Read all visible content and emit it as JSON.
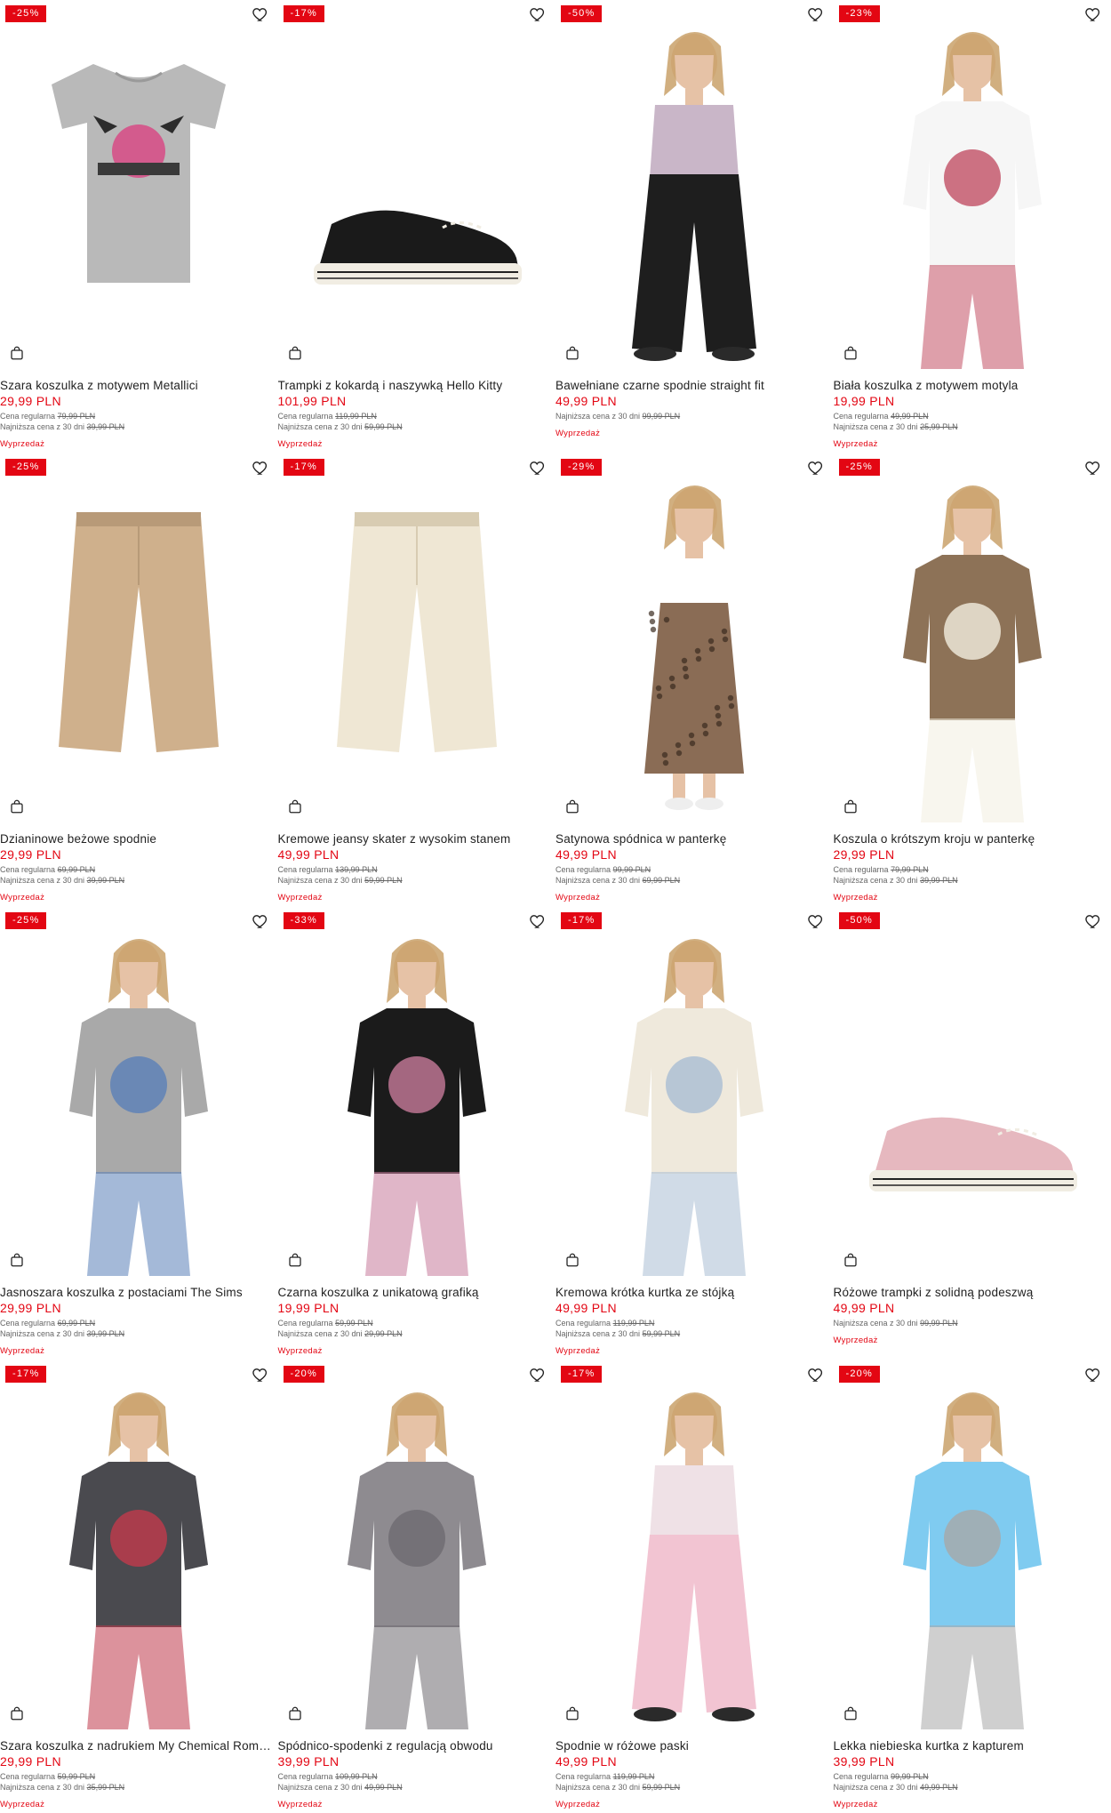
{
  "labels": {
    "regular": "Cena regularna",
    "lowest": "Najniższa cena z 30 dni",
    "sale": "Wyprzedaż"
  },
  "products": [
    {
      "name": "Szara koszulka z motywem Metallici",
      "price": "29,99 PLN",
      "badge": "-25%",
      "regular": "79,99 PLN",
      "lowest": "39,99 PLN",
      "kind": "tee",
      "color": "#b9b9b9",
      "accent": "#d35b8d"
    },
    {
      "name": "Trampki z kokardą i naszywką Hello Kitty",
      "price": "101,99 PLN",
      "badge": "-17%",
      "regular": "119,99 PLN",
      "lowest": "59,99 PLN",
      "kind": "shoe",
      "color": "#1a1a1a",
      "accent": "#f1ede3"
    },
    {
      "name": "Bawełniane czarne spodnie straight fit",
      "price": "49,99 PLN",
      "badge": "-50%",
      "regular": "",
      "lowest": "99,99 PLN",
      "kind": "pants-model",
      "color": "#1e1e1e",
      "accent": "#c9b6c8"
    },
    {
      "name": "Biała koszulka z motywem motyla",
      "price": "19,99 PLN",
      "badge": "-23%",
      "regular": "49,99 PLN",
      "lowest": "25,99 PLN",
      "kind": "model",
      "color": "#f6f6f6",
      "accent": "#c25065"
    },
    {
      "name": "Dzianinowe beżowe spodnie",
      "price": "29,99 PLN",
      "badge": "-25%",
      "regular": "69,99 PLN",
      "lowest": "39,99 PLN",
      "kind": "pants",
      "color": "#cfb08c",
      "accent": "#b89a78"
    },
    {
      "name": "Kremowe jeansy skater z wysokim stanem",
      "price": "49,99 PLN",
      "badge": "-17%",
      "regular": "139,99 PLN",
      "lowest": "59,99 PLN",
      "kind": "pants",
      "color": "#efe7d4",
      "accent": "#d8ccb2"
    },
    {
      "name": "Satynowa spódnica w panterkę",
      "price": "49,99 PLN",
      "badge": "-29%",
      "regular": "99,99 PLN",
      "lowest": "69,99 PLN",
      "kind": "skirt-model",
      "color": "#8a6c55",
      "accent": "#ffffff"
    },
    {
      "name": "Koszula o krótszym kroju w panterkę",
      "price": "29,99 PLN",
      "badge": "-25%",
      "regular": "79,99 PLN",
      "lowest": "39,99 PLN",
      "kind": "model",
      "color": "#8d7257",
      "accent": "#f3eee0"
    },
    {
      "name": "Jasnoszara koszulka z postaciami The Sims",
      "price": "29,99 PLN",
      "badge": "-25%",
      "regular": "69,99 PLN",
      "lowest": "39,99 PLN",
      "kind": "model",
      "color": "#a9a9a9",
      "accent": "#5a7fb8"
    },
    {
      "name": "Czarna koszulka z unikatową grafiką",
      "price": "19,99 PLN",
      "badge": "-33%",
      "regular": "59,99 PLN",
      "lowest": "29,99 PLN",
      "kind": "model",
      "color": "#1b1b1b",
      "accent": "#c77a9a"
    },
    {
      "name": "Kremowa krótka kurtka ze stójką",
      "price": "49,99 PLN",
      "badge": "-17%",
      "regular": "119,99 PLN",
      "lowest": "59,99 PLN",
      "kind": "model",
      "color": "#efe9dc",
      "accent": "#a9bdd3"
    },
    {
      "name": "Różowe trampki z solidną podeszwą",
      "price": "49,99 PLN",
      "badge": "-50%",
      "regular": "",
      "lowest": "99,99 PLN",
      "kind": "shoe",
      "color": "#e6b8bf",
      "accent": "#f1ede3"
    },
    {
      "name": "Szara koszulka z nadrukiem My Chemical Roma...",
      "price": "29,99 PLN",
      "badge": "-17%",
      "regular": "59,99 PLN",
      "lowest": "35,99 PLN",
      "kind": "model",
      "color": "#4a4a4f",
      "accent": "#c0394b"
    },
    {
      "name": "Spódnico-spodenki z regulacją obwodu",
      "price": "39,99 PLN",
      "badge": "-20%",
      "regular": "109,99 PLN",
      "lowest": "49,99 PLN",
      "kind": "model",
      "color": "#8e8b90",
      "accent": "#6e6a70"
    },
    {
      "name": "Spodnie w różowe paski",
      "price": "49,99 PLN",
      "badge": "-17%",
      "regular": "119,99 PLN",
      "lowest": "59,99 PLN",
      "kind": "pants-model",
      "color": "#f2c4d2",
      "accent": "#efe1e6"
    },
    {
      "name": "Lekka niebieska kurtka z kapturem",
      "price": "39,99 PLN",
      "badge": "-20%",
      "regular": "99,99 PLN",
      "lowest": "49,99 PLN",
      "kind": "model",
      "color": "#7fcbf0",
      "accent": "#a8a8a8"
    }
  ]
}
